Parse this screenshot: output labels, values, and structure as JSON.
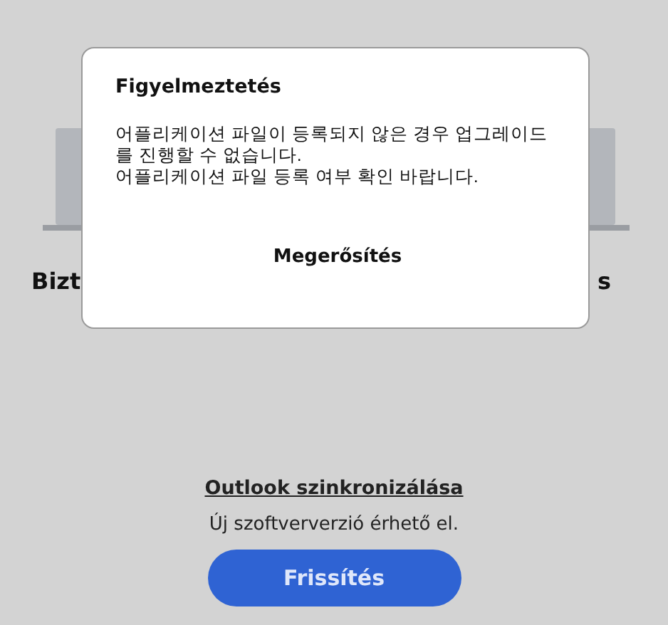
{
  "background": {
    "devices": [
      {
        "label": "Bizt"
      },
      {
        "label": "s"
      }
    ]
  },
  "dialog": {
    "title": "Figyelmeztetés",
    "message_lines": [
      "어플리케이션 파일이 등록되지 않은 경우 업그레이드",
      "를 진행할 수 없습니다.",
      "어플리케이션 파일 등록 여부 확인 바랍니다."
    ],
    "button": "Megerősítés"
  },
  "sync": {
    "link": "Outlook szinkronizálása",
    "notice": "Új szoftververzió érhető el.",
    "button": "Frissítés"
  }
}
